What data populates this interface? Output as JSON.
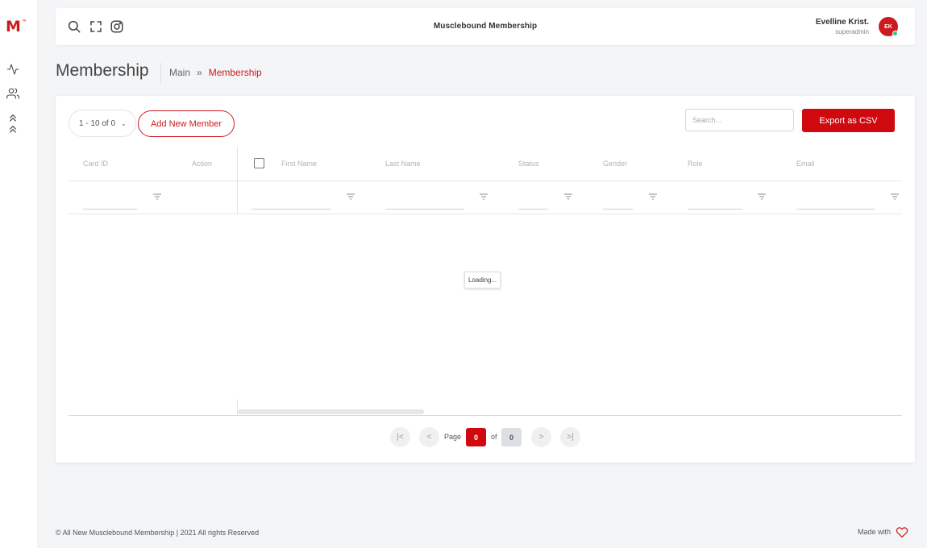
{
  "app": {
    "logo_text": "M",
    "logo_mark": "™",
    "title": "Musclebound Membership"
  },
  "user": {
    "name": "Evelline Krist.",
    "role": "superadmin",
    "initials": "EK",
    "status_color": "#2ecc71"
  },
  "colors": {
    "accent": "#d0090f",
    "brand": "#cc1b1f"
  },
  "page": {
    "title": "Membership",
    "breadcrumb": {
      "root": "Main",
      "separator": "»",
      "current": "Membership"
    }
  },
  "toolbar": {
    "page_size_label": "1 - 10 of 0",
    "add_label": "Add New Member",
    "search_placeholder": "Search...",
    "export_label": "Export as CSV"
  },
  "grid": {
    "columns": [
      "Card ID",
      "Action",
      "First Name",
      "Last Name",
      "Status",
      "Gender",
      "Role",
      "Email"
    ],
    "loading_text": "Loading..."
  },
  "pagination": {
    "page_label": "Page",
    "of_label": "of",
    "current": "0",
    "total": "0"
  },
  "footer": {
    "copyright": "© All New Musclebound Membership | 2021 All rights Reserved",
    "made_with": "Made with"
  },
  "icons": {
    "sidebar": [
      "activity-icon",
      "users-icon",
      "chevrons-up-icon"
    ],
    "topbar": [
      "search-icon",
      "fullscreen-icon",
      "instagram-icon"
    ],
    "footer": "heart-icon"
  }
}
